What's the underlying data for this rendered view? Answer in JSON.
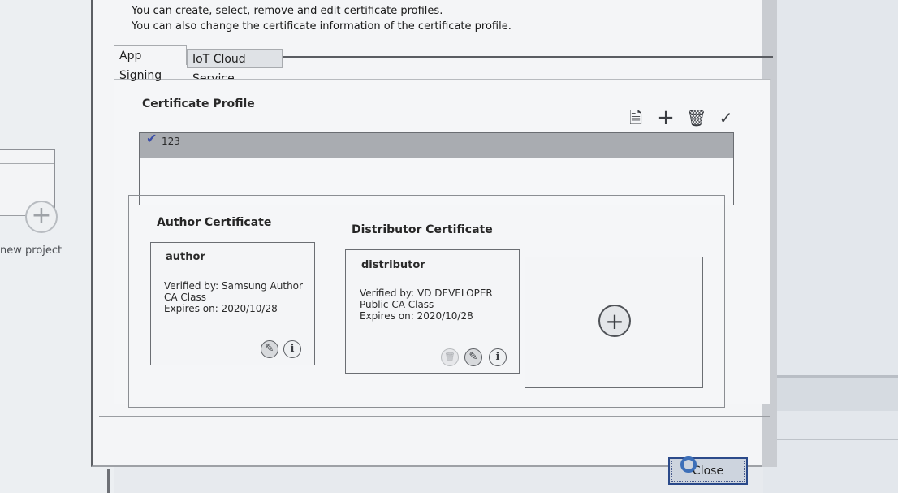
{
  "background": {
    "new_project_label": "new project",
    "plus_glyph": "+"
  },
  "description": {
    "line1": "You can create, select, remove and edit certificate profiles.",
    "line2": "You can also change the certificate information of the certificate profile."
  },
  "tabs": [
    {
      "label": "App Signing",
      "selected": true
    },
    {
      "label": "IoT Cloud Service",
      "selected": false
    }
  ],
  "certificate_profile": {
    "label": "Certificate Profile",
    "toolbar_icons": [
      "import-icon",
      "add-icon",
      "trash-icon",
      "check-icon"
    ],
    "toolbar_glyphs": [
      "🗎",
      "+",
      "🗑",
      "✓"
    ],
    "profiles": [
      {
        "name": "123",
        "active": true,
        "check_glyph": "✔"
      }
    ]
  },
  "author_certificate": {
    "title": "Author Certificate",
    "name": "author",
    "verified_by_line1": "Verified by: Samsung Author",
    "verified_by_line2": "CA Class",
    "expires": "Expires on: 2020/10/28"
  },
  "distributor_certificate": {
    "title": "Distributor Certificate",
    "name": "distributor",
    "verified_by_line1": "Verified by: VD DEVELOPER",
    "verified_by_line2": "Public CA Class",
    "expires": "Expires on: 2020/10/28",
    "add_glyph": "+"
  },
  "card_glyphs": {
    "edit": "✎",
    "info": "i",
    "delete": "🗑"
  },
  "footer": {
    "close_label": "Close"
  },
  "colors": {
    "accent": "#2b4a8a",
    "selection": "#a9acb1",
    "check": "#3b4ea8"
  }
}
